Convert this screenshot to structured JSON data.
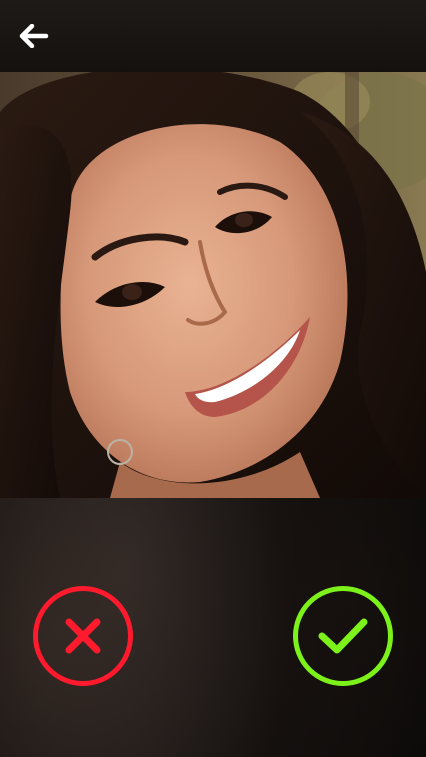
{
  "header": {
    "back_icon": "arrow-left-icon"
  },
  "photo": {
    "subject": "profile-photo"
  },
  "actions": {
    "reject_icon": "x-icon",
    "accept_icon": "checkmark-icon",
    "reject_color": "#ff1a2d",
    "accept_color": "#7df21a"
  }
}
